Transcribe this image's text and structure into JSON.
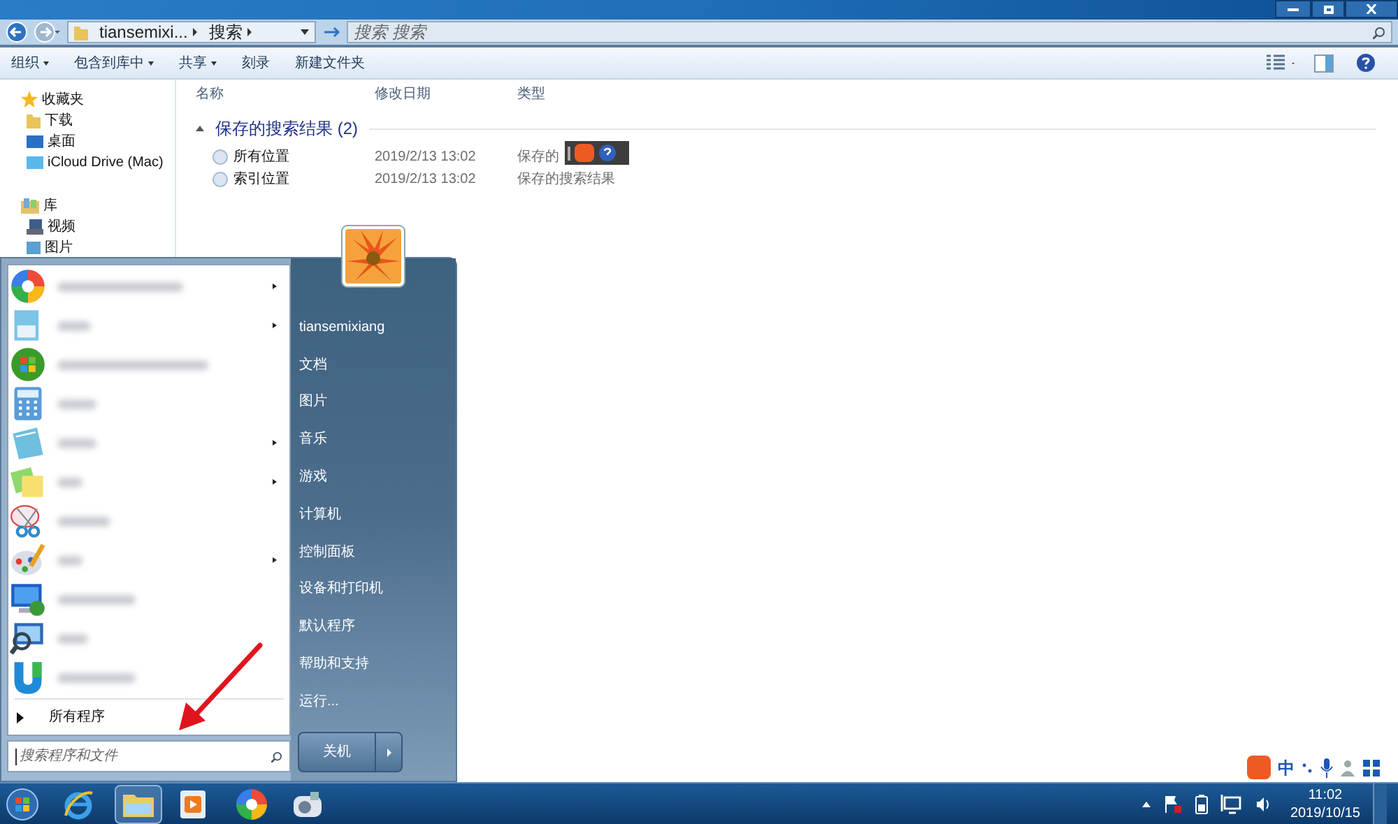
{
  "window": {
    "breadcrumb": [
      "tiansemixi...",
      "搜索"
    ],
    "search_placeholder": "搜索 搜索"
  },
  "toolbar": [
    {
      "label": "组织",
      "dropdown": true
    },
    {
      "label": "包含到库中",
      "dropdown": true
    },
    {
      "label": "共享",
      "dropdown": true
    },
    {
      "label": "刻录",
      "dropdown": false
    },
    {
      "label": "新建文件夹",
      "dropdown": false
    }
  ],
  "nav": [
    {
      "label": "收藏夹",
      "children": [
        {
          "label": "下载"
        },
        {
          "label": "桌面"
        },
        {
          "label": "iCloud Drive (Mac)"
        }
      ]
    },
    {
      "label": "库",
      "children": [
        {
          "label": "视频"
        },
        {
          "label": "图片"
        }
      ]
    }
  ],
  "columns": [
    "名称",
    "修改日期",
    "类型"
  ],
  "group": {
    "title": "保存的搜索结果 (2)",
    "expanded": true
  },
  "rows": [
    {
      "name": "所有位置",
      "date": "2019/2/13 13:02",
      "type": "保存的"
    },
    {
      "name": "索引位置",
      "date": "2019/2/13 13:02",
      "type": "保存的搜索结果"
    }
  ],
  "start_menu": {
    "programs": [
      {
        "submenu": true
      },
      {
        "submenu": true
      },
      {
        "submenu": false
      },
      {
        "submenu": false
      },
      {
        "submenu": true
      },
      {
        "submenu": true
      },
      {
        "submenu": false
      },
      {
        "submenu": true
      },
      {
        "submenu": false
      },
      {
        "submenu": false
      },
      {
        "submenu": false
      }
    ],
    "all_programs": "所有程序",
    "search_placeholder": "搜索程序和文件",
    "places": [
      "tiansemixiang",
      "文档",
      "图片",
      "音乐",
      "游戏",
      "计算机",
      "控制面板",
      "设备和打印机",
      "默认程序",
      "帮助和支持",
      "运行..."
    ],
    "shutdown": "关机"
  },
  "tray": {
    "ime": "中",
    "time": "11:02",
    "date": "2019/10/15"
  }
}
